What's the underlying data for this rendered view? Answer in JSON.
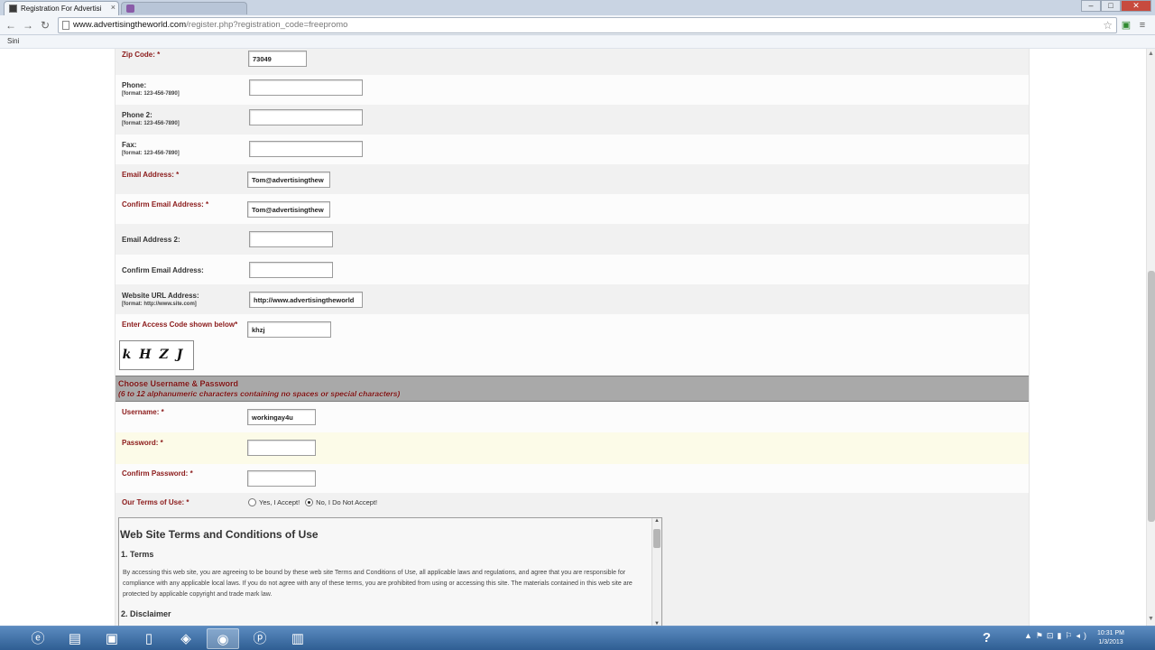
{
  "browser": {
    "active_tab_title": "Registration For Advertisi",
    "url_domain": "www.advertisingtheworld.com",
    "url_path": "/register.php?registration_code=freepromo",
    "bookmark_label": "Sini",
    "tab_close": "×",
    "win_minimize": "–",
    "win_maximize": "□",
    "win_close": "✕",
    "back": "←",
    "forward": "→",
    "reload": "↻",
    "star": "☆",
    "menu": "≡"
  },
  "form": {
    "zip": {
      "label": "Zip Code: *",
      "value": "73049"
    },
    "phone": {
      "label": "Phone:",
      "format": "[format: 123-456-7890]",
      "value": ""
    },
    "phone2": {
      "label": "Phone 2:",
      "format": "[format: 123-456-7890]",
      "value": ""
    },
    "fax": {
      "label": "Fax:",
      "format": "[format: 123-456-7890]",
      "value": ""
    },
    "email": {
      "label": "Email Address: *",
      "value": "Tom@advertisingthew"
    },
    "confirm_email": {
      "label": "Confirm Email Address: *",
      "value": "Tom@advertisingthew"
    },
    "email2": {
      "label": "Email Address 2:",
      "value": ""
    },
    "confirm_email2": {
      "label": "Confirm Email Address:",
      "value": ""
    },
    "website": {
      "label": "Website URL Address:",
      "format": "[format: http://www.site.com]",
      "value": "http://www.advertisingtheworld"
    },
    "access_code": {
      "label": "Enter Access Code shown below*",
      "value": "khzj"
    },
    "captcha_text": "kHZJ"
  },
  "credentials": {
    "section_title": "Choose Username & Password",
    "section_subtitle": "(6 to 12 alphanumeric characters containing no spaces or special characters)",
    "username": {
      "label": "Username: *",
      "value": "workingay4u"
    },
    "password": {
      "label": "Password: *",
      "value": ""
    },
    "confirm_password": {
      "label": "Confirm Password: *",
      "value": ""
    },
    "terms_label": "Our Terms of Use: *",
    "accept_label": "Yes, I Accept!",
    "decline_label": "No, I Do Not Accept!",
    "selected": "decline"
  },
  "terms": {
    "title": "Web Site Terms and Conditions of Use",
    "h1": "1. Terms",
    "p1": "By accessing this web site, you are agreeing to be bound by these web site Terms and Conditions of Use, all applicable laws and regulations, and agree that you are responsible for compliance with any applicable local laws. If you do not agree with any of these terms, you are prohibited from using or accessing this site. The materials contained in this web site are protected by applicable copyright and trade mark law.",
    "h2": "2. Disclaimer"
  },
  "taskbar": {
    "clock_time": "10:31 PM",
    "clock_date": "1/3/2013",
    "help": "?",
    "tray_icons": "▲⚑⊡▮⚐◂)"
  }
}
